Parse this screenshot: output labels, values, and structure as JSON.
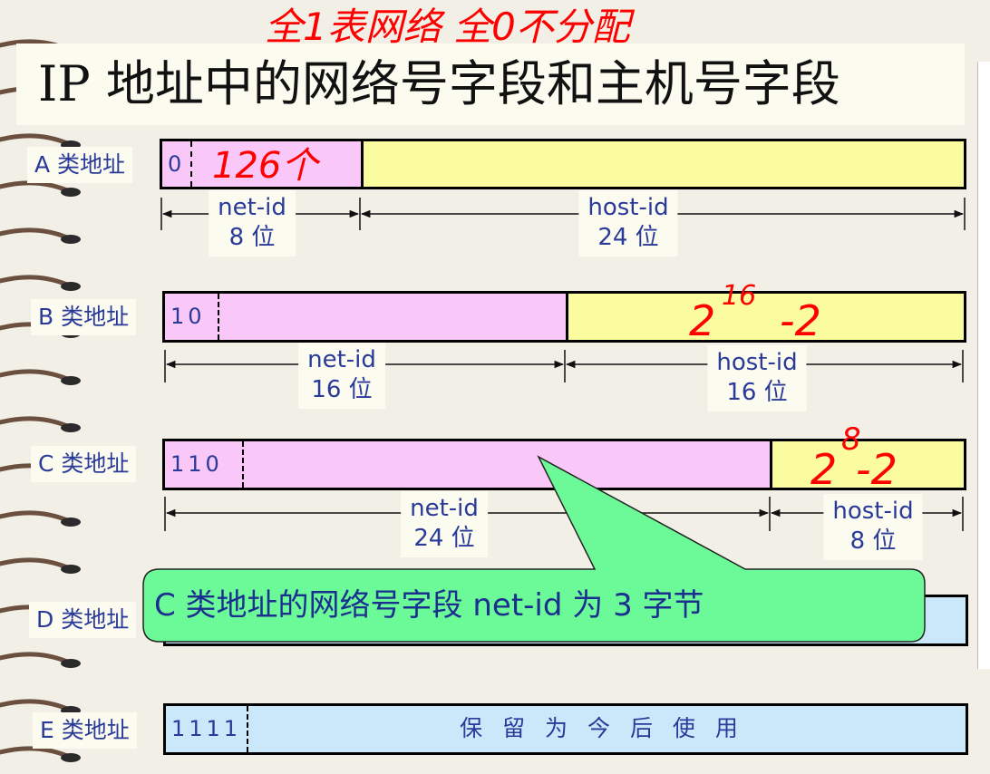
{
  "title": "IP 地址中的网络号字段和主机号字段",
  "classes": [
    {
      "label": "A 类地址",
      "bits": "0"
    },
    {
      "label": "B 类地址",
      "bits": "10"
    },
    {
      "label": "C 类地址",
      "bits": "110"
    },
    {
      "label": "D 类地址"
    },
    {
      "label": "E 类地址",
      "bits": "1111",
      "reserved_text": "保 留 为 今 后 使 用"
    }
  ],
  "dims": {
    "a_net": {
      "name": "net-id",
      "size": "8 位"
    },
    "a_host": {
      "name": "host-id",
      "size": "24 位"
    },
    "b_net": {
      "name": "net-id",
      "size": "16 位"
    },
    "b_host": {
      "name": "host-id",
      "size": "16 位"
    },
    "c_net": {
      "name": "net-id",
      "size": "24 位"
    },
    "c_host": {
      "name": "host-id",
      "size": "8 位"
    }
  },
  "callout": "C 类地址的网络号字段 net-id 为 3 字节",
  "annotations": {
    "top": "全1表网络 全0不分配",
    "a": "126个",
    "b_base": "2",
    "b_exp": "16",
    "b_minus": "-2",
    "c_base": "2",
    "c_exp": "8",
    "c_minus": "-2"
  },
  "colors": {
    "net": "#fac8f8",
    "host": "#fbfba0",
    "reserved": "#cbe8fb",
    "callout": "#6cfa98",
    "label_text": "#2a3a99",
    "ink": "#ff0000"
  }
}
